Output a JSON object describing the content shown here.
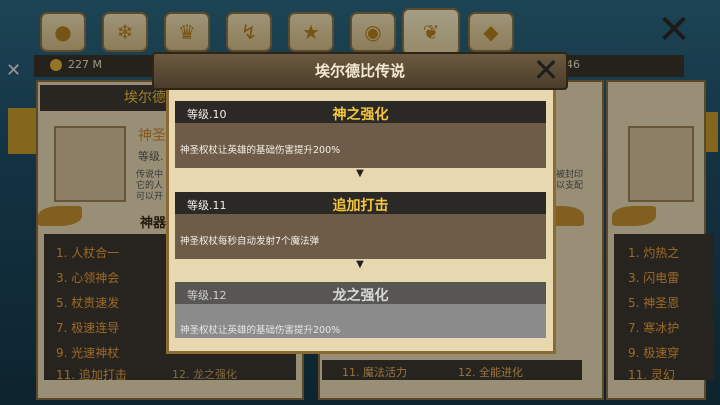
{
  "background": {
    "tab_icons": [
      "person-icon",
      "deer-icon",
      "crown-icon",
      "lightning-icon",
      "trophy-icon",
      "orb-icon",
      "emblem-icon",
      "gem-icon"
    ],
    "gold": "227 M",
    "right_number": "46",
    "left_panel": {
      "header": "埃尔德",
      "sub_title": "神圣",
      "level": "等级.",
      "desc_lines": [
        "传说中",
        "它的人",
        "可以开"
      ],
      "section_title": "神器",
      "list": [
        "1. 人杖合一",
        "3. 心领神会",
        "5. 杖责速发",
        "7. 极速连导",
        "9. 光速神杖",
        "11. 追加打击"
      ],
      "list_col2_last": "12. 龙之强化"
    },
    "mid_panel": {
      "right_text_1": "被封印",
      "right_text_2": "以支配",
      "bottom_left": "11. 魔法活力",
      "bottom_right": "12. 全能进化"
    },
    "right_panel": {
      "list": [
        "1. 灼热之",
        "3. 闪电雷",
        "5. 神圣恩",
        "7. 寒冰护",
        "9. 极速穿",
        "11. 灵幻"
      ]
    }
  },
  "modal": {
    "title": "埃尔德比传说",
    "cards": [
      {
        "level": "等级.10",
        "name": "神之强化",
        "desc": "神圣权杖让英雄的基础伤害提升200%",
        "active": true
      },
      {
        "level": "等级.11",
        "name": "追加打击",
        "desc": "神圣权杖每秒自动发射7个魔法弹",
        "active": true
      },
      {
        "level": "等级.12",
        "name": "龙之强化",
        "desc": "神圣权杖让英雄的基础伤害提升200%",
        "active": false
      }
    ]
  },
  "colors": {
    "gold_text": "#f4c63d",
    "card_active_body": "#6e5c49",
    "card_locked_body": "#8b8b8b"
  }
}
